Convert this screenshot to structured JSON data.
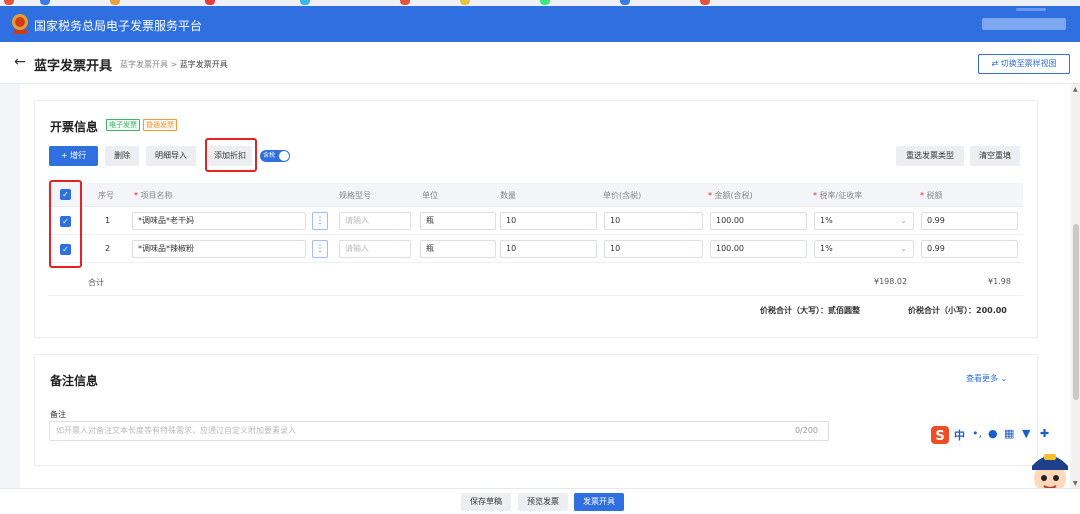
{
  "app": {
    "title": "国家税务总局电子发票服务平台"
  },
  "header": {
    "back_glyph": "←",
    "page_title": "蓝字发票开具",
    "breadcrumb": [
      "蓝字发票开具",
      "蓝字发票开具"
    ],
    "breadcrumb_sep": ">",
    "switch_view": "⇄ 切换至票样视图"
  },
  "invoice_info": {
    "title": "开票信息",
    "tags": [
      "电子发票",
      "普通发票"
    ],
    "toolbar": {
      "add": "+ 增行",
      "delete": "删除",
      "import": "明细导入",
      "add_discount": "添加折扣",
      "tax_included_toggle": "含税",
      "reselect_type": "重选发票类型",
      "clear": "清空重填"
    },
    "columns": [
      "序号",
      "项目名称",
      "规格型号",
      "单位",
      "数量",
      "单价(含税)",
      "金额(含税)",
      "税率/征收率",
      "税额"
    ],
    "required_columns": [
      false,
      true,
      false,
      false,
      false,
      false,
      true,
      true,
      true
    ],
    "rows": [
      {
        "no": "1",
        "name": "*调味品*老干妈",
        "spec_placeholder": "请输入",
        "unit": "瓶",
        "qty": "10",
        "price": "10",
        "amount": "100.00",
        "rate": "1%",
        "tax": "0.99"
      },
      {
        "no": "2",
        "name": "*调味品*辣椒粉",
        "spec_placeholder": "请输入",
        "unit": "瓶",
        "qty": "10",
        "price": "10",
        "amount": "100.00",
        "rate": "1%",
        "tax": "0.99"
      }
    ],
    "total_label": "合计",
    "total_amount": "¥198.02",
    "total_tax": "¥1.98",
    "sum_upper_label": "价税合计（大写）：",
    "sum_upper_value": "贰佰圆整",
    "sum_lower_label": "价税合计（小写）：",
    "sum_lower_value": "200.00"
  },
  "remark": {
    "title": "备注信息",
    "see_more": "查看更多 ⌄",
    "label": "备注",
    "placeholder": "如开票人对备注文本长度等有特殊需求，应通过自定义附加要素录入",
    "counter": "0/200"
  },
  "footer": {
    "save_draft": "保存草稿",
    "preview": "预览发票",
    "issue": "发票开具"
  },
  "ime": {
    "items": [
      "中",
      "•,",
      "🎤",
      "▦",
      "👕",
      "✿"
    ]
  },
  "colors": {
    "primary": "#2f6fe0",
    "highlight": "#e02424",
    "green_tag": "#3fb56c",
    "orange_tag": "#f39a3a"
  }
}
